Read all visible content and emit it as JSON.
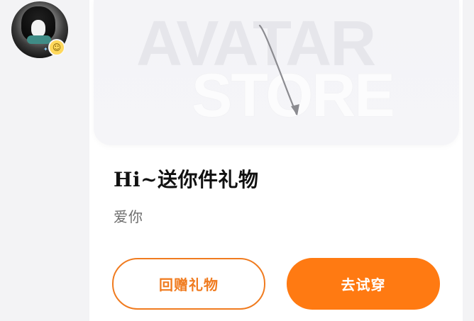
{
  "profile": {
    "avatar_icon": "user-avatar",
    "emoji_icon": "smiley-badge"
  },
  "banner": {
    "watermark_line_1": "AVATAR",
    "watermark_line_2": "STORE",
    "arrow_icon": "curved-arrow-pointer"
  },
  "content": {
    "title": "Hi~送你件礼物",
    "message": "爱你"
  },
  "actions": {
    "return_gift": "回赠礼物",
    "try_on": "去试穿"
  },
  "colors": {
    "accent": "#ff7a12",
    "accent_border": "#f07b1f",
    "text_primary": "#111111",
    "text_secondary": "#6d6d6d",
    "background": "#f3f3f5",
    "card": "#ffffff"
  }
}
